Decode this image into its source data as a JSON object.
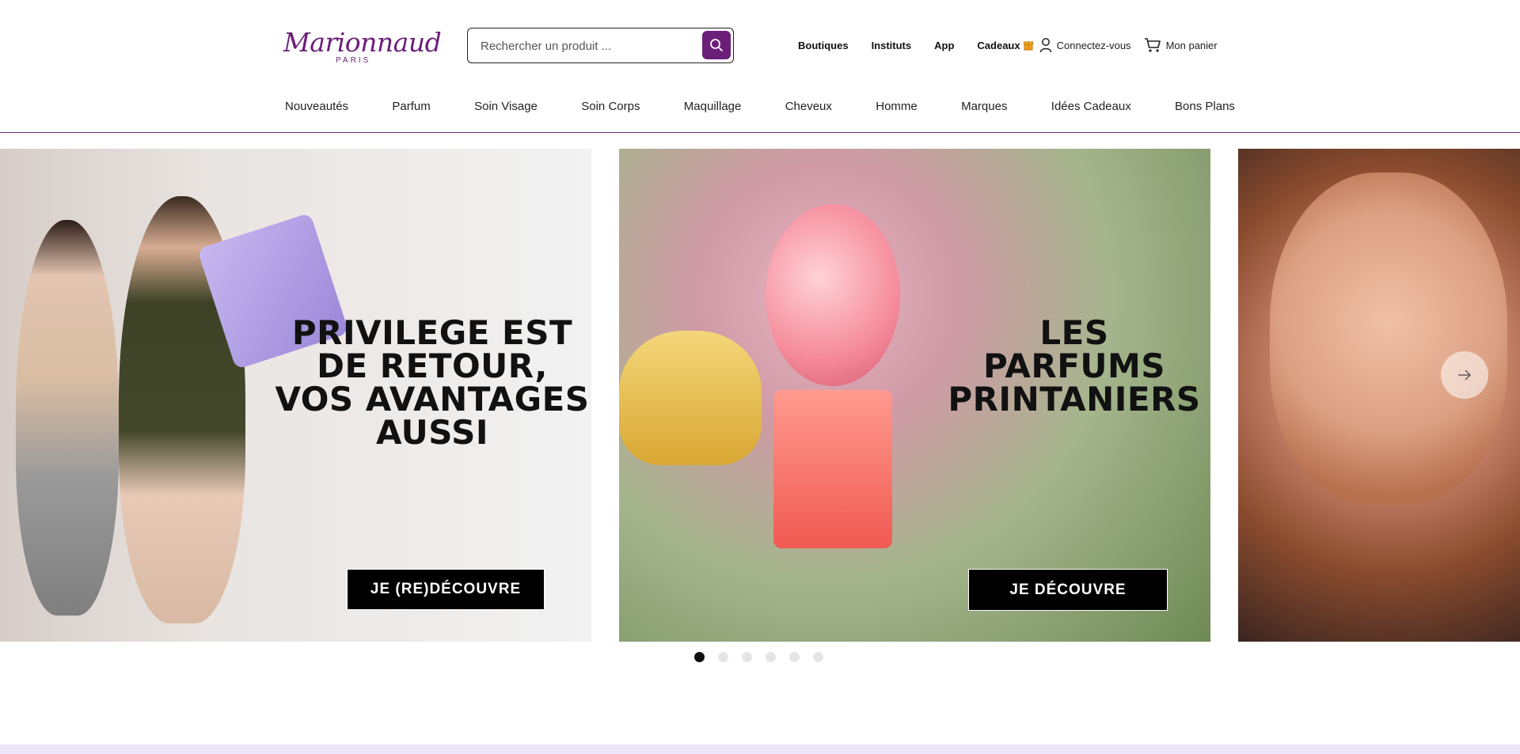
{
  "brand": {
    "name": "Marionnaud",
    "subtitle": "PARIS",
    "color": "#6b1f79"
  },
  "search": {
    "placeholder": "Rechercher un produit ...",
    "icon": "search-icon"
  },
  "top_links": {
    "boutiques": "Boutiques",
    "instituts": "Instituts",
    "app": "App",
    "cadeaux": "Cadeaux",
    "login": "Connectez-vous",
    "cart": "Mon panier"
  },
  "nav": [
    "Nouveautés",
    "Parfum",
    "Soin Visage",
    "Soin Corps",
    "Maquillage",
    "Cheveux",
    "Homme",
    "Marques",
    "Idées Cadeaux",
    "Bons Plans"
  ],
  "slides": [
    {
      "headline": "PRIVILEGE EST DE RETOUR, VOS AVANTAGES AUSSI",
      "cta": "JE (RE)DÉCOUVRE"
    },
    {
      "headline": "LES PARFUMS PRINTANIERS",
      "cta": "JE DÉCOUVRE"
    }
  ],
  "carousel": {
    "dot_count": 6,
    "active_index": 0
  },
  "colors": {
    "accent": "#6b1f79",
    "cta_bg": "#000000",
    "band": "#ede6fb"
  }
}
